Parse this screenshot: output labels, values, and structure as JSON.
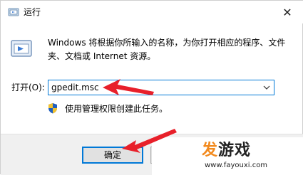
{
  "window": {
    "title": "运行",
    "close_glyph": "✕"
  },
  "body": {
    "description": "Windows 将根据你所输入的名称，为你打开相应的程序、文件夹、文档或 Internet 资源。",
    "open_label": "打开(O):",
    "command_value": "gpedit.msc",
    "admin_notice": "使用管理权限创建此任务。"
  },
  "buttons": {
    "ok": "确定",
    "cancel": "",
    "browse": ""
  },
  "watermark": {
    "fa": "发",
    "rest": "游戏",
    "url": "www.fayouxi.com"
  },
  "annotations": {
    "arrow_color": "#e8202a"
  },
  "icons": [
    "run-app-icon",
    "run-large-icon",
    "shield-icon",
    "close-icon",
    "dropdown-arrow-icon",
    "red-arrow-annotation"
  ]
}
